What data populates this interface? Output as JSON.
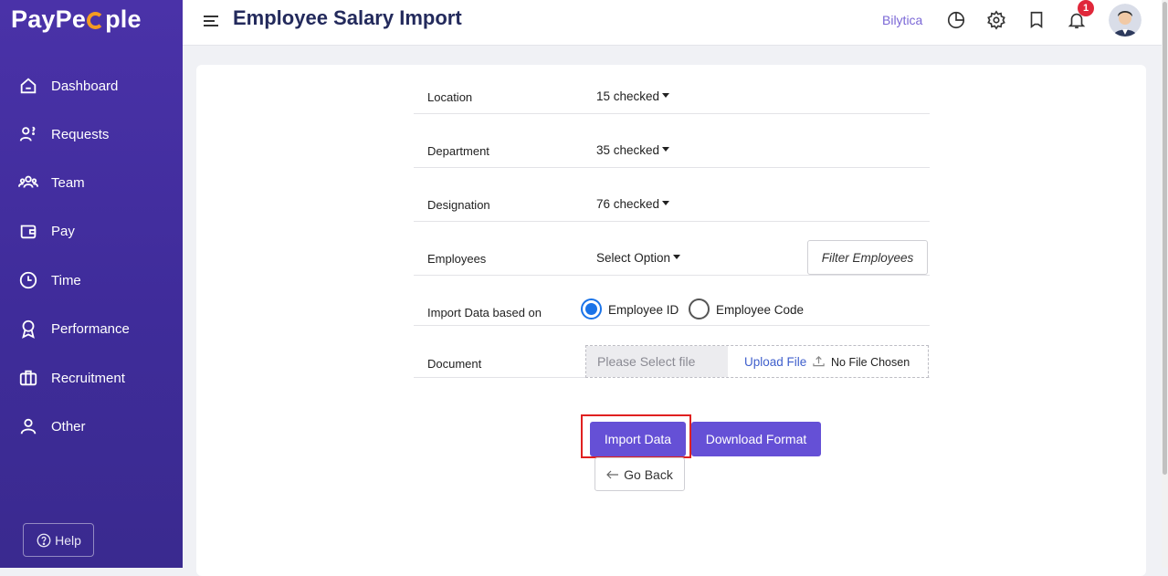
{
  "app": {
    "logo_pre": "PayPe",
    "logo_post": "ple",
    "page_title": "Employee Salary Import",
    "company": "Bilytica",
    "notification_count": "1"
  },
  "sidebar": {
    "items": [
      {
        "label": "Dashboard",
        "icon": "home-icon"
      },
      {
        "label": "Requests",
        "icon": "request-icon"
      },
      {
        "label": "Team",
        "icon": "team-icon"
      },
      {
        "label": "Pay",
        "icon": "wallet-icon"
      },
      {
        "label": "Time",
        "icon": "clock-icon"
      },
      {
        "label": "Performance",
        "icon": "award-icon"
      },
      {
        "label": "Recruitment",
        "icon": "briefcase-icon"
      },
      {
        "label": "Other",
        "icon": "user-icon"
      }
    ],
    "help_label": "Help"
  },
  "form": {
    "location": {
      "label": "Location",
      "value": "15 checked"
    },
    "department": {
      "label": "Department",
      "value": "35 checked"
    },
    "designation": {
      "label": "Designation",
      "value": "76 checked"
    },
    "employees": {
      "label": "Employees",
      "value": "Select Option",
      "filter_label": "Filter Employees"
    },
    "import_basis": {
      "label": "Import Data based on",
      "options": [
        "Employee ID",
        "Employee Code"
      ],
      "selected": "Employee ID"
    },
    "document": {
      "label": "Document",
      "placeholder": "Please Select file",
      "upload_label": "Upload File",
      "file_status": "No File Chosen"
    }
  },
  "actions": {
    "import_label": "Import Data",
    "download_label": "Download Format",
    "back_label": "Go Back"
  },
  "colors": {
    "sidebar": "#4a32a8",
    "primary_button": "#6550d6",
    "title": "#232a5c",
    "highlight": "#e02020",
    "radio_active": "#1a73e8"
  }
}
